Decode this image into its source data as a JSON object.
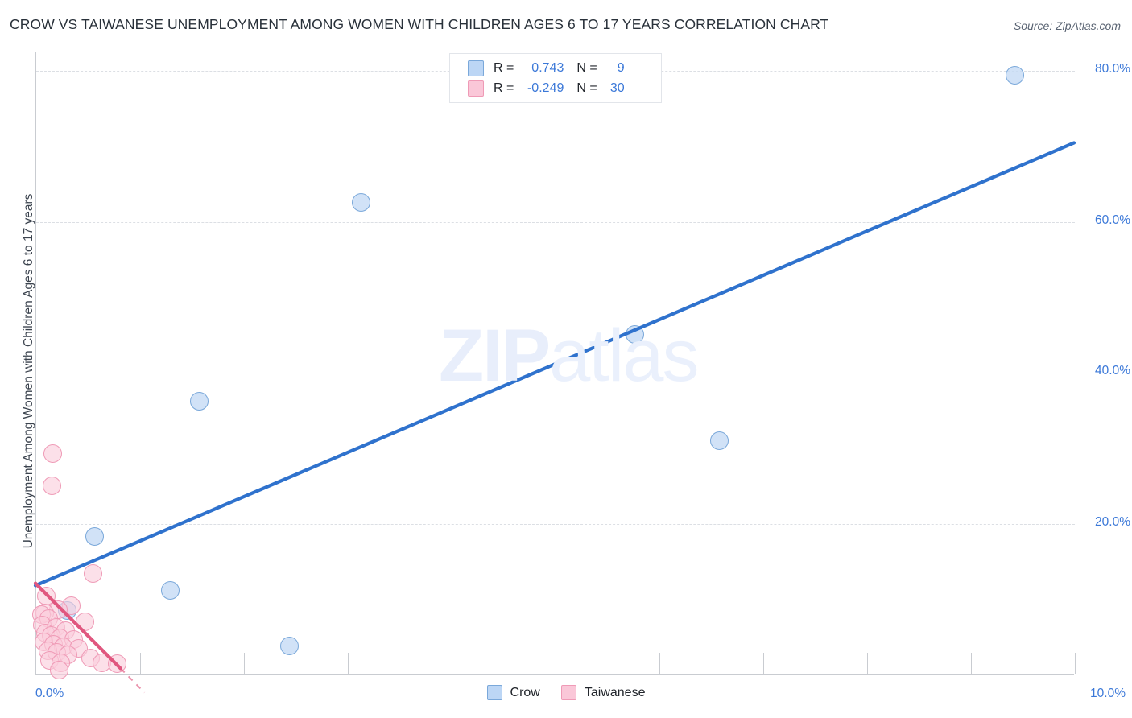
{
  "header": {
    "title": "CROW VS TAIWANESE UNEMPLOYMENT AMONG WOMEN WITH CHILDREN AGES 6 TO 17 YEARS CORRELATION CHART",
    "source": "Source: ZipAtlas.com"
  },
  "stats_legend": {
    "rows": [
      {
        "series": "Crow",
        "r_label": "R =",
        "r_value": "0.743",
        "n_label": "N =",
        "n_value": "9",
        "color": "#bcd6f5"
      },
      {
        "series": "Taiwanese",
        "r_label": "R =",
        "r_value": "-0.249",
        "n_label": "N =",
        "n_value": "30",
        "color": "#fac7d8"
      }
    ]
  },
  "series_legend": [
    {
      "label": "Crow",
      "color": "#bcd6f5"
    },
    {
      "label": "Taiwanese",
      "color": "#fac7d8"
    }
  ],
  "watermark": {
    "bold": "ZIP",
    "light": "atlas"
  },
  "chart_data": {
    "type": "scatter",
    "title": "CROW VS TAIWANESE UNEMPLOYMENT AMONG WOMEN WITH CHILDREN AGES 6 TO 17 YEARS CORRELATION CHART",
    "xlabel": "",
    "ylabel": "Unemployment Among Women with Children Ages 6 to 17 years",
    "xlim": [
      0,
      10
    ],
    "ylim": [
      0,
      82.5
    ],
    "grid": true,
    "legend_position": "bottom-center",
    "x_tick_labels": [
      "0.0%",
      "10.0%"
    ],
    "x_ticks": [
      0,
      1,
      2,
      3,
      4,
      5,
      6,
      7,
      8,
      9,
      10
    ],
    "y_tick_labels": [
      "20.0%",
      "40.0%",
      "60.0%",
      "80.0%"
    ],
    "y_ticks": [
      20,
      40,
      60,
      80
    ],
    "series": [
      {
        "name": "Crow",
        "color": "#bcd6f5",
        "edge_color": "#7aa8da",
        "r": 0.743,
        "n": 9,
        "points": [
          {
            "x": 9.42,
            "y": 79.5
          },
          {
            "x": 3.13,
            "y": 62.6
          },
          {
            "x": 5.76,
            "y": 45.1
          },
          {
            "x": 1.57,
            "y": 36.2
          },
          {
            "x": 6.58,
            "y": 31.0
          },
          {
            "x": 0.56,
            "y": 18.3
          },
          {
            "x": 1.29,
            "y": 11.1
          },
          {
            "x": 2.44,
            "y": 3.8
          },
          {
            "x": 0.3,
            "y": 8.5
          }
        ],
        "trend_line": {
          "x0": 0,
          "y0": 11.8,
          "x1": 10,
          "y1": 70.5
        }
      },
      {
        "name": "Taiwanese",
        "color": "#fac7d8",
        "edge_color": "#ef9ab6",
        "r": -0.249,
        "n": 30,
        "points": [
          {
            "x": 0.16,
            "y": 29.3
          },
          {
            "x": 0.15,
            "y": 25.0
          },
          {
            "x": 0.55,
            "y": 13.4
          },
          {
            "x": 0.1,
            "y": 10.4
          },
          {
            "x": 0.34,
            "y": 9.1
          },
          {
            "x": 0.21,
            "y": 8.6
          },
          {
            "x": 0.08,
            "y": 8.2
          },
          {
            "x": 0.05,
            "y": 7.9
          },
          {
            "x": 0.12,
            "y": 7.4
          },
          {
            "x": 0.47,
            "y": 7.0
          },
          {
            "x": 0.06,
            "y": 6.6
          },
          {
            "x": 0.19,
            "y": 6.2
          },
          {
            "x": 0.28,
            "y": 5.8
          },
          {
            "x": 0.09,
            "y": 5.5
          },
          {
            "x": 0.14,
            "y": 5.2
          },
          {
            "x": 0.23,
            "y": 4.9
          },
          {
            "x": 0.36,
            "y": 4.6
          },
          {
            "x": 0.07,
            "y": 4.3
          },
          {
            "x": 0.17,
            "y": 4.0
          },
          {
            "x": 0.26,
            "y": 3.7
          },
          {
            "x": 0.41,
            "y": 3.5
          },
          {
            "x": 0.11,
            "y": 3.2
          },
          {
            "x": 0.2,
            "y": 2.9
          },
          {
            "x": 0.31,
            "y": 2.6
          },
          {
            "x": 0.52,
            "y": 2.2
          },
          {
            "x": 0.13,
            "y": 1.9
          },
          {
            "x": 0.24,
            "y": 1.5
          },
          {
            "x": 0.63,
            "y": 1.6
          },
          {
            "x": 0.78,
            "y": 1.4
          },
          {
            "x": 0.22,
            "y": 0.6
          }
        ],
        "trend_line": {
          "x0": 0,
          "y0": 12.1,
          "x1": 0.82,
          "y1": 0.8
        },
        "trend_line_dashed": {
          "x0": 0.82,
          "y0": 0.8,
          "x1": 1.05,
          "y1": -2.4
        }
      }
    ]
  }
}
